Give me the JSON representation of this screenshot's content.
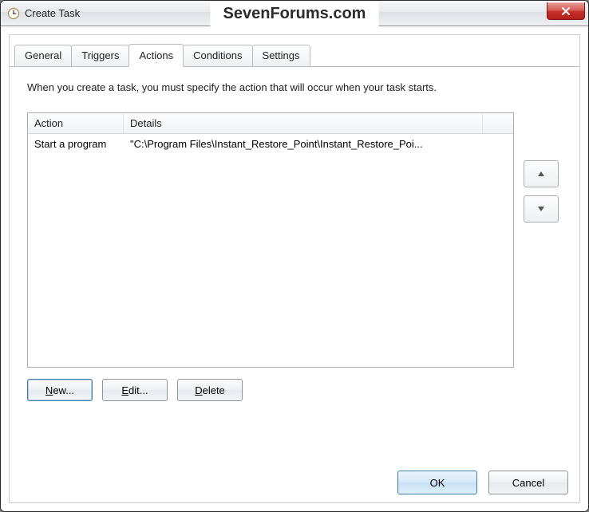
{
  "window": {
    "title": "Create Task",
    "watermark": "SevenForums.com"
  },
  "tabs": {
    "general": "General",
    "triggers": "Triggers",
    "actions": "Actions",
    "conditions": "Conditions",
    "settings": "Settings",
    "active": "actions"
  },
  "actions_tab": {
    "intro": "When you create a task, you must specify the action that will occur when your task starts.",
    "columns": {
      "action": "Action",
      "details": "Details"
    },
    "rows": [
      {
        "action": "Start a program",
        "details": "\"C:\\Program Files\\Instant_Restore_Point\\Instant_Restore_Poi..."
      }
    ],
    "buttons": {
      "new": "New...",
      "edit": "Edit...",
      "delete": "Delete"
    }
  },
  "dialog_buttons": {
    "ok": "OK",
    "cancel": "Cancel"
  }
}
